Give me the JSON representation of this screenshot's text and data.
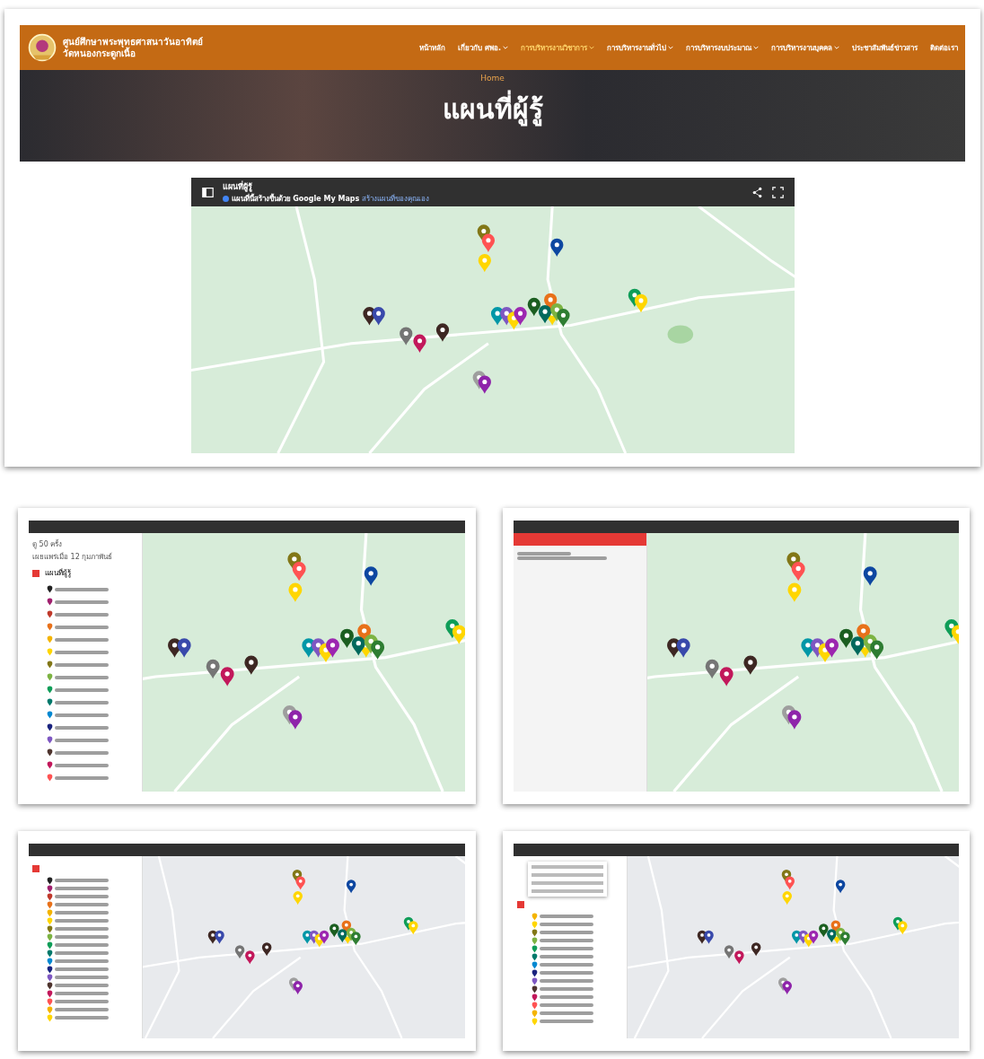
{
  "website": {
    "site_title": "ศูนย์ศึกษาพระพุทธศาสนาวันอาทิตย์",
    "site_subtitle": "วัดหนองกระดูกเนื้อ",
    "nav": [
      {
        "label": "หน้าหลัก",
        "dropdown": false,
        "selected": false
      },
      {
        "label": "เกี่ยวกับ ศพอ.",
        "dropdown": true,
        "selected": false
      },
      {
        "label": "การบริหารงานวิชาการ",
        "dropdown": true,
        "selected": true
      },
      {
        "label": "การบริหารงานทั่วไป",
        "dropdown": true,
        "selected": false
      },
      {
        "label": "การบริหารงบประมาณ",
        "dropdown": true,
        "selected": false
      },
      {
        "label": "การบริหารงานบุคคล",
        "dropdown": true,
        "selected": false
      },
      {
        "label": "ประชาสัมพันธ์ข่าวสาร",
        "dropdown": false,
        "selected": false
      },
      {
        "label": "ติดต่อเรา",
        "dropdown": false,
        "selected": false
      }
    ],
    "breadcrumb": "Home",
    "hero_title": "แผนที่ผู้รู้",
    "embed": {
      "title": "แผนที่ผู้รู้",
      "note": "แผนที่นี้สร้างขึ้นด้วย Google My Maps",
      "link": "สร้างแผนที่ของคุณเอง"
    }
  },
  "screenshots": [
    {
      "kind": "legend",
      "muted_map": false,
      "menu_open": false,
      "views": "ดู 50 ครั้ง",
      "published": "เผยแพร่เมื่อ 12 กุมภาพันธ์",
      "layer": "แผนที่ผู้รู้",
      "layer_checked": true,
      "legend": [
        {
          "color": "#212121"
        },
        {
          "color": "#a0206e"
        },
        {
          "color": "#c0392b"
        },
        {
          "color": "#e8711a"
        },
        {
          "color": "#f4b400"
        },
        {
          "color": "#ffd600"
        },
        {
          "color": "#827717"
        },
        {
          "color": "#7cb342"
        },
        {
          "color": "#0f9d58"
        },
        {
          "color": "#00796b"
        },
        {
          "color": "#0288d1"
        },
        {
          "color": "#1a237e"
        },
        {
          "color": "#7e57c2"
        },
        {
          "color": "#4e342e"
        },
        {
          "color": "#c2185b"
        },
        {
          "color": "#ff5252"
        }
      ]
    },
    {
      "kind": "detail",
      "muted_map": false
    },
    {
      "kind": "legend",
      "muted_map": true,
      "menu_open": false,
      "layer_checked": true,
      "legend": [
        {
          "color": "#212121"
        },
        {
          "color": "#a0206e"
        },
        {
          "color": "#c0392b"
        },
        {
          "color": "#e8711a"
        },
        {
          "color": "#f4b400"
        },
        {
          "color": "#ffd600"
        },
        {
          "color": "#827717"
        },
        {
          "color": "#7cb342"
        },
        {
          "color": "#0f9d58"
        },
        {
          "color": "#00796b"
        },
        {
          "color": "#0288d1"
        },
        {
          "color": "#1a237e"
        },
        {
          "color": "#7e57c2"
        },
        {
          "color": "#4e342e"
        },
        {
          "color": "#c2185b"
        },
        {
          "color": "#ff5252"
        },
        {
          "color": "#f4b400"
        },
        {
          "color": "#ffd600"
        }
      ]
    },
    {
      "kind": "legend",
      "muted_map": true,
      "menu_open": true,
      "layer_checked": true,
      "legend": [
        {
          "color": "#f4b400"
        },
        {
          "color": "#ffd600"
        },
        {
          "color": "#827717"
        },
        {
          "color": "#7cb342"
        },
        {
          "color": "#0f9d58"
        },
        {
          "color": "#00796b"
        },
        {
          "color": "#0288d1"
        },
        {
          "color": "#1a237e"
        },
        {
          "color": "#7e57c2"
        },
        {
          "color": "#4e342e"
        },
        {
          "color": "#c2185b"
        },
        {
          "color": "#ff5252"
        },
        {
          "color": "#f4b400"
        },
        {
          "color": "#ffd600"
        }
      ]
    }
  ]
}
